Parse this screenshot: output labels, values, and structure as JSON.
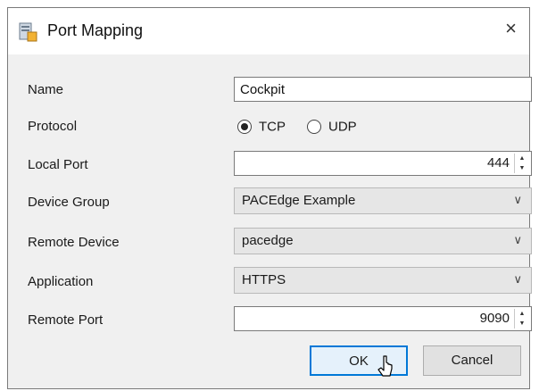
{
  "window": {
    "title": "Port Mapping",
    "close_glyph": "×"
  },
  "icons": {
    "title": "port-mapping-icon",
    "close": "close-icon",
    "cursor": "mouse-pointer-icon"
  },
  "form": {
    "name": {
      "label": "Name",
      "value": "Cockpit"
    },
    "protocol": {
      "label": "Protocol",
      "options": [
        "TCP",
        "UDP"
      ],
      "selected": "TCP"
    },
    "local_port": {
      "label": "Local Port",
      "value": "444"
    },
    "device_group": {
      "label": "Device Group",
      "value": "PACEdge Example"
    },
    "remote_device": {
      "label": "Remote Device",
      "value": "pacedge"
    },
    "application": {
      "label": "Application",
      "value": "HTTPS"
    },
    "remote_port": {
      "label": "Remote Port",
      "value": "9090"
    }
  },
  "buttons": {
    "ok": "OK",
    "cancel": "Cancel"
  },
  "colors": {
    "accent": "#0078d7",
    "dialog_bg": "#f0f0f0",
    "select_bg": "#e6e6e6"
  }
}
